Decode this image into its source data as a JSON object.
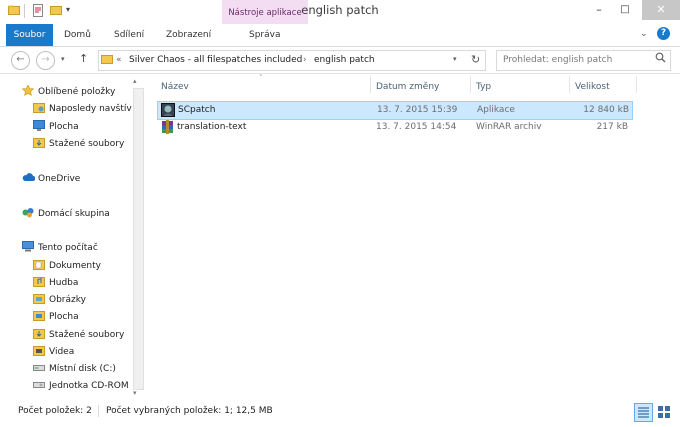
{
  "window": {
    "title": "english patch",
    "minimize": "–",
    "maximize": "□",
    "close": "✕"
  },
  "ribbon": {
    "tabs": [
      "Soubor",
      "Domů",
      "Sdílení",
      "Zobrazení",
      "Správa"
    ],
    "contextual_group": "Nástroje aplikace",
    "accent_color": "#1979ca",
    "contextual_color": "#f3ddf3"
  },
  "address": {
    "prefix": "«",
    "crumbs": [
      "Silver Chaos - all filespatches included",
      "english patch"
    ],
    "separator": "›",
    "search_placeholder": "Prohledat: english patch"
  },
  "nav": {
    "groups": [
      {
        "label": "Oblíbené položky",
        "icon": "star-icon",
        "items": [
          "Naposledy navštív",
          "Plocha",
          "Stažené soubory"
        ]
      },
      {
        "label": "OneDrive",
        "icon": "cloud-icon",
        "items": []
      },
      {
        "label": "Domácí skupina",
        "icon": "homegroup-icon",
        "items": []
      },
      {
        "label": "Tento počítač",
        "icon": "computer-icon",
        "items": [
          "Dokumenty",
          "Hudba",
          "Obrázky",
          "Plocha",
          "Stažené soubory",
          "Videa",
          "Místní disk (C:)",
          "Jednotka CD-ROM"
        ]
      }
    ]
  },
  "columns": [
    "Název",
    "Datum změny",
    "Typ",
    "Velikost"
  ],
  "files": [
    {
      "name": "SCpatch",
      "date": "13. 7. 2015 15:39",
      "type": "Aplikace",
      "size": "12 840 kB",
      "icon": "application-icon",
      "selected": true
    },
    {
      "name": "translation-text",
      "date": "13. 7. 2015 14:54",
      "type": "WinRAR archiv",
      "size": "217 kB",
      "icon": "winrar-archive-icon",
      "selected": false
    }
  ],
  "status": {
    "count": "Počet položek: 2",
    "selection": "Počet vybraných položek: 1; 12,5 MB"
  }
}
